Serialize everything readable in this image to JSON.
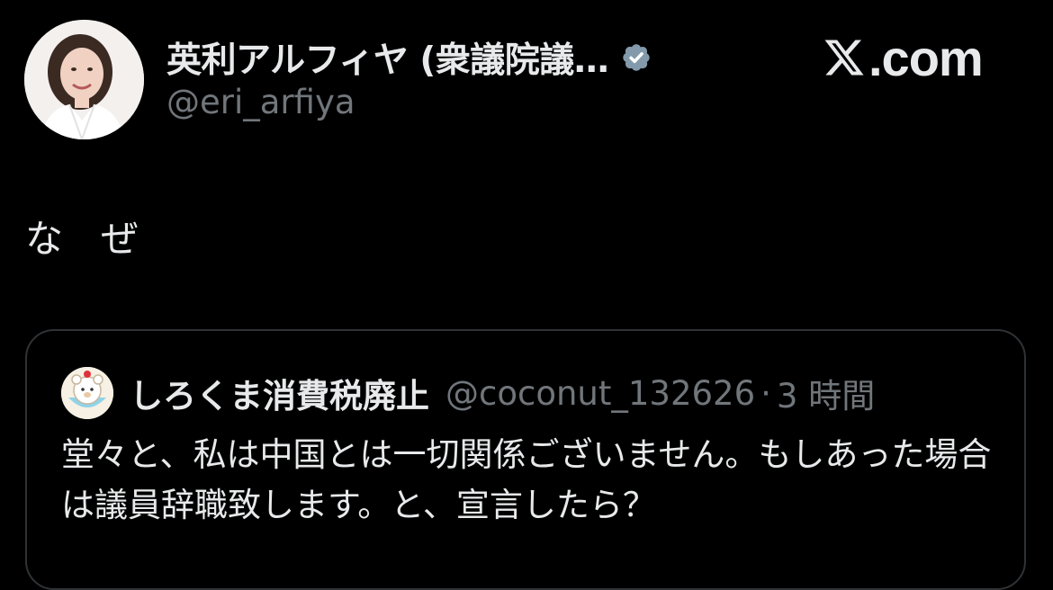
{
  "author": {
    "name": "英利アルフィヤ (衆議院議…",
    "handle": "@eri_arfiya",
    "verified": true,
    "verified_badge_color": "#829aab"
  },
  "site_logo": {
    "text": ".com",
    "icon": "x-logo-icon"
  },
  "tweet": {
    "text": "な　ぜ"
  },
  "quoted_tweet": {
    "author_name": "しろくま消費税廃止",
    "author_handle": "@coconut_132626",
    "separator": "·",
    "time": "3 時間",
    "text": "堂々と、私は中国とは一切関係ございません。もしあった場合は議員辞職致します。と、宣言したら？"
  },
  "colors": {
    "background": "#000000",
    "primary_text": "#e7e9ea",
    "secondary_text": "#71767b",
    "card_border": "#2f3336"
  }
}
